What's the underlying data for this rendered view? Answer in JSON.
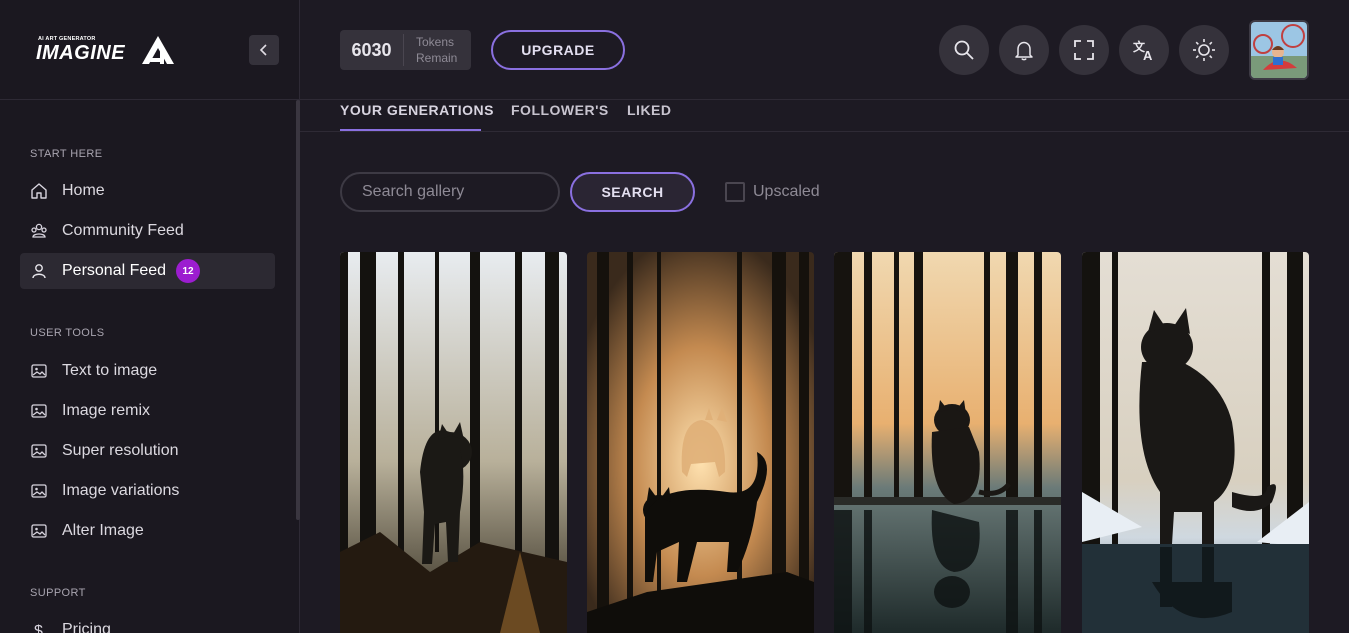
{
  "sidebar": {
    "logo_small": "AI ART GENERATOR",
    "logo_big": "IMAGINE",
    "sections": [
      {
        "title": "START HERE"
      },
      {
        "title": "USER TOOLS"
      },
      {
        "title": "SUPPORT"
      }
    ],
    "items": [
      {
        "label": "Home",
        "icon": "home-icon"
      },
      {
        "label": "Community Feed",
        "icon": "community-icon"
      },
      {
        "label": "Personal Feed",
        "icon": "user-icon",
        "badge": "12"
      },
      {
        "label": "Text to image",
        "icon": "image-icon"
      },
      {
        "label": "Image remix",
        "icon": "image-icon"
      },
      {
        "label": "Super resolution",
        "icon": "image-icon"
      },
      {
        "label": "Image variations",
        "icon": "image-icon"
      },
      {
        "label": "Alter Image",
        "icon": "image-icon"
      },
      {
        "label": "Pricing",
        "icon": "dollar-icon"
      }
    ]
  },
  "header": {
    "tokens_value": "6030",
    "tokens_label_1": "Tokens",
    "tokens_label_2": "Remain",
    "upgrade_label": "UPGRADE",
    "icons": [
      "search-icon",
      "bell-icon",
      "fullscreen-icon",
      "translate-icon",
      "sun-icon"
    ]
  },
  "tabs": [
    {
      "label": "YOUR GENERATIONS",
      "active": true
    },
    {
      "label": "FOLLOWER'S",
      "active": false
    },
    {
      "label": "LIKED",
      "active": false
    }
  ],
  "search": {
    "placeholder": "Search gallery",
    "button_label": "SEARCH",
    "upscaled_label": "Upscaled"
  },
  "colors": {
    "accent": "#8a70e0",
    "badge": "#9c1dd0",
    "background": "#1d1a23"
  }
}
